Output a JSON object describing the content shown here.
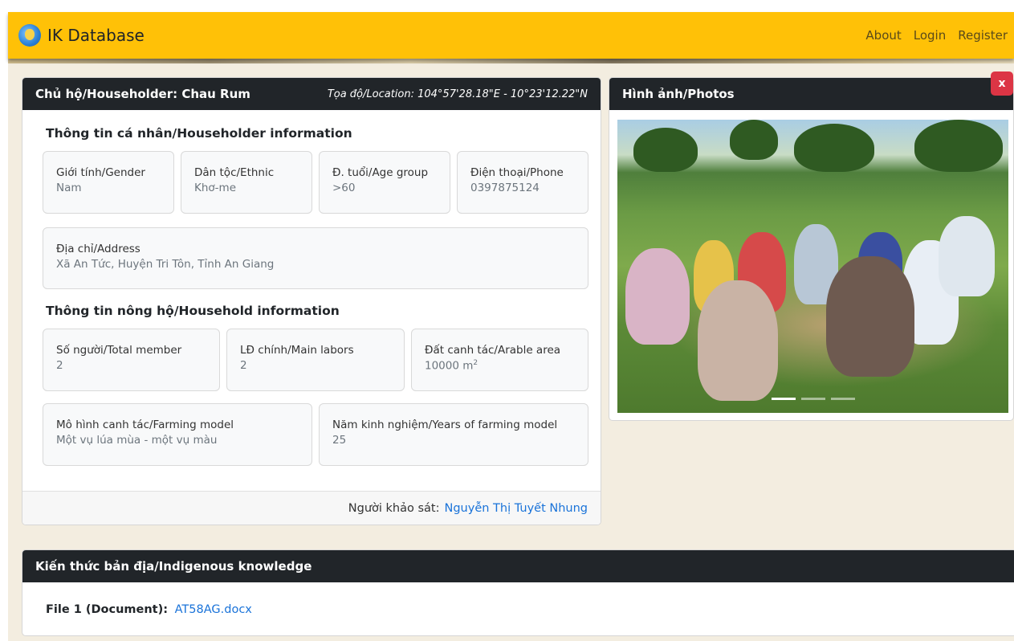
{
  "navbar": {
    "brand": "IK Database",
    "links": [
      "About",
      "Login",
      "Register"
    ],
    "color": "#ffc107"
  },
  "householder": {
    "title": "Chủ hộ/Householder: Chau Rum",
    "location": "Tọa độ/Location: 104°57'28.18\"E - 10°23'12.22\"N",
    "personal_section": "Thông tin cá nhân/Householder information",
    "gender": {
      "label": "Giới tính/Gender",
      "value": "Nam"
    },
    "ethnic": {
      "label": "Dân tộc/Ethnic",
      "value": "Khơ-me"
    },
    "age": {
      "label": "Đ. tuổi/Age group",
      "value": ">60"
    },
    "phone": {
      "label": "Điện thoại/Phone",
      "value": "0397875124"
    },
    "address": {
      "label": "Địa chỉ/Address",
      "value": "Xã An Tức, Huyện Tri Tôn, Tỉnh An Giang"
    },
    "household_section": "Thông tin nông hộ/Household information",
    "total_member": {
      "label": "Số người/Total member",
      "value": "2"
    },
    "main_labors": {
      "label": "LĐ chính/Main labors",
      "value": "2"
    },
    "arable_area": {
      "label": "Đất canh tác/Arable area",
      "value": "10000 m",
      "unit_sup": "2"
    },
    "farming_model": {
      "label": "Mô hình canh tác/Farming model",
      "value": "Một vụ lúa mùa - một vụ màu"
    },
    "years": {
      "label": "Năm kinh nghiệm/Years of farming model",
      "value": "25"
    },
    "surveyor_label": "Người khảo sát:",
    "surveyor_name": "Nguyễn Thị Tuyết Nhung"
  },
  "photos": {
    "title": "Hình ảnh/Photos",
    "close": "x",
    "slides": 3,
    "active_slide": 1
  },
  "knowledge": {
    "title": "Kiến thức bản địa/Indigenous knowledge",
    "file_label": "File 1 (Document):",
    "file_name": "AT58AG.docx"
  }
}
